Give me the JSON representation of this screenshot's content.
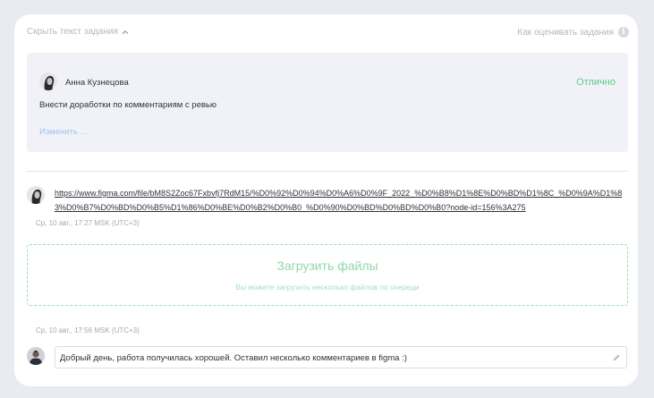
{
  "header": {
    "hide_task_label": "Скрыть текст задания",
    "how_rate_label": "Как оценивать задания",
    "info_icon": "i"
  },
  "review": {
    "reviewer_name": "Анна Кузнецова",
    "grade": "Отлично",
    "text": "Внести доработки по комментариям с ревью",
    "edit_label": "Изменить ..."
  },
  "message": {
    "link": "https://www.figma.com/file/bM8S2Zoc67Fxbvfj7RdM15/%D0%92%D0%94%D0%A6%D0%9F_2022_%D0%B8%D1%8E%D0%BD%D1%8C_%D0%9A%D1%83%D0%B7%D0%BD%D0%B5%D1%86%D0%BE%D0%B2%D0%B0_%D0%90%D0%BD%D0%BD%D0%B0?node-id=156%3A275",
    "time": "Ср, 10 авг., 17:27 MSK (UTC+3)"
  },
  "upload": {
    "title": "Загрузить файлы",
    "subtitle": "Вы можете загрузить несколько файлов по очереди"
  },
  "comment": {
    "time": "Ср, 10 авг., 17:56 MSK (UTC+3)",
    "text": "Добрый день, работа получилась хорошей. Оставил несколько комментариев в figma :)"
  },
  "colors": {
    "page_background": "#e9ebf3",
    "grade_green": "#5bc98a",
    "link_blue": "#9ec3f1",
    "upload_green": "#8fd7ad"
  }
}
